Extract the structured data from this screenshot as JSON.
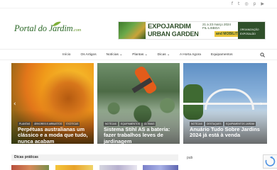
{
  "social": {
    "icons": [
      "facebook-icon",
      "twitter-icon",
      "instagram-icon",
      "pinterest-icon",
      "youtube-icon"
    ],
    "glyphs": [
      "f",
      "t",
      "◎",
      "p",
      "▶"
    ]
  },
  "logo": {
    "name": "Portal do Jardim",
    "tld": ".com"
  },
  "banner": {
    "title_line1": "EXPOJARDIM",
    "date": "21 a 23 março 2024",
    "location": "FIL-LISBOA",
    "title_line2": "URBAN GARDEN",
    "and_mobility": "and MOBILITY",
    "right_line1": "ORGANIZAÇÃO",
    "right_line2": "EXPOSALÃO"
  },
  "nav": {
    "items": [
      "Início",
      "Os Artigos",
      "Notícias ⌄",
      "Plantas ⌄",
      "Dicas ⌄",
      "A Horta Agora",
      "Equipamentos"
    ]
  },
  "slider": {
    "slides": [
      {
        "tags": [
          "PLANTAS",
          "ÁRVORES E ARBUSTOS",
          "EXOTICAS"
        ],
        "title": "Perpétuas australianas um clássico e a moda que tudo, nunca acabam"
      },
      {
        "tags": [
          "NOTÍCIAS",
          "EQUIPAMENTOS",
          "ÚLTIMAS"
        ],
        "title": "Sistema Stihl AS a bateria: fazer trabalhos leves de jardinagem"
      },
      {
        "tags": [
          "NOTÍCIAS",
          "DESTAQUES",
          "EQUIPAMENTOS JARDIM"
        ],
        "title": "Anuário Tudo Sobre Jardins 2024 já está à venda"
      }
    ],
    "prev_arrow": "‹",
    "next_arrow": "›"
  },
  "sections": {
    "latest_label": "Dicas práticas",
    "sidebar_label": "pub"
  },
  "colors": {
    "brand_green": "#2f6b2a",
    "banner_green": "#2f4f2a",
    "banner_yellow": "#e8c43a"
  }
}
